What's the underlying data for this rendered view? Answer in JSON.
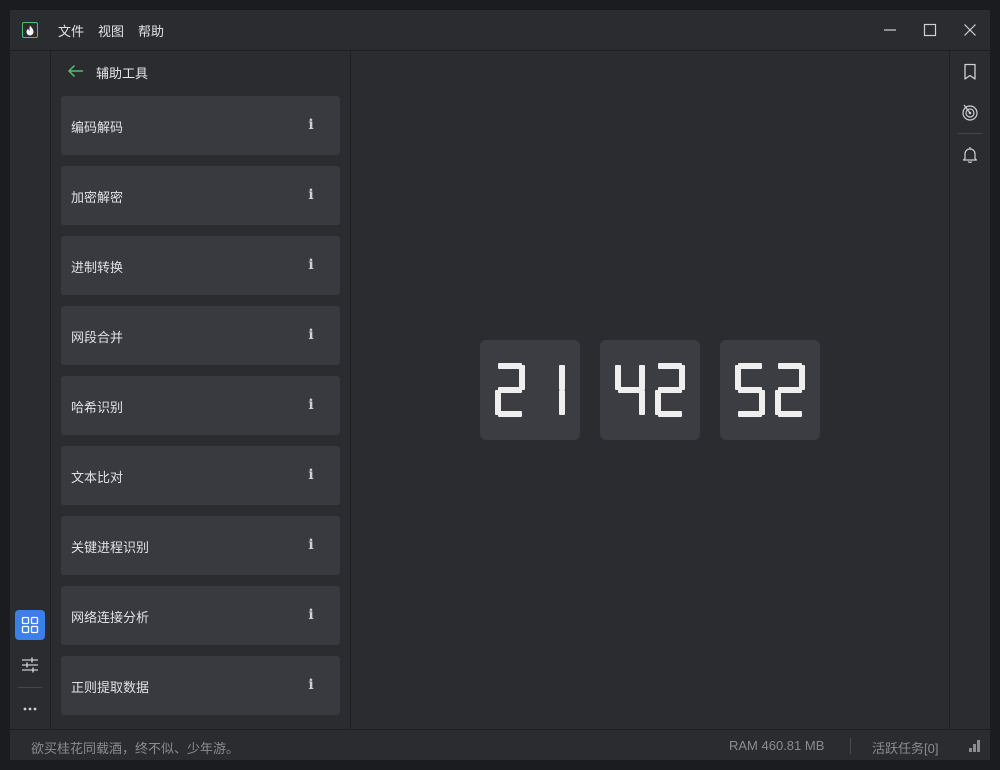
{
  "menu": {
    "file": "文件",
    "view": "视图",
    "help": "帮助"
  },
  "panel": {
    "title": "辅助工具",
    "items": [
      {
        "label": "编码解码"
      },
      {
        "label": "加密解密"
      },
      {
        "label": "进制转换"
      },
      {
        "label": "网段合并"
      },
      {
        "label": "哈希识别"
      },
      {
        "label": "文本比对"
      },
      {
        "label": "关键进程识别"
      },
      {
        "label": "网络连接分析"
      },
      {
        "label": "正则提取数据"
      }
    ],
    "info_glyph": "i"
  },
  "clock": {
    "hours": "21",
    "minutes": "42",
    "seconds": "52"
  },
  "status": {
    "quote": "欲买桂花同载酒，终不似、少年游。",
    "ram": "RAM 460.81 MB",
    "tasks": "活跃任务[0]"
  },
  "colors": {
    "accent": "#3d7fe8",
    "brand": "#4fc06f",
    "card": "#393a3f",
    "background": "#2b2c30"
  },
  "icons": {
    "logo": "fire-icon",
    "back": "arrow-left-icon",
    "apps": "grid-icon",
    "settings": "sliders-icon",
    "more": "ellipsis-icon",
    "bookmark": "bookmark-icon",
    "target": "target-icon",
    "notifications": "bell-icon",
    "minimize": "minimize-icon",
    "maximize": "maximize-icon",
    "close": "close-icon",
    "status": "signal-bars-icon"
  }
}
